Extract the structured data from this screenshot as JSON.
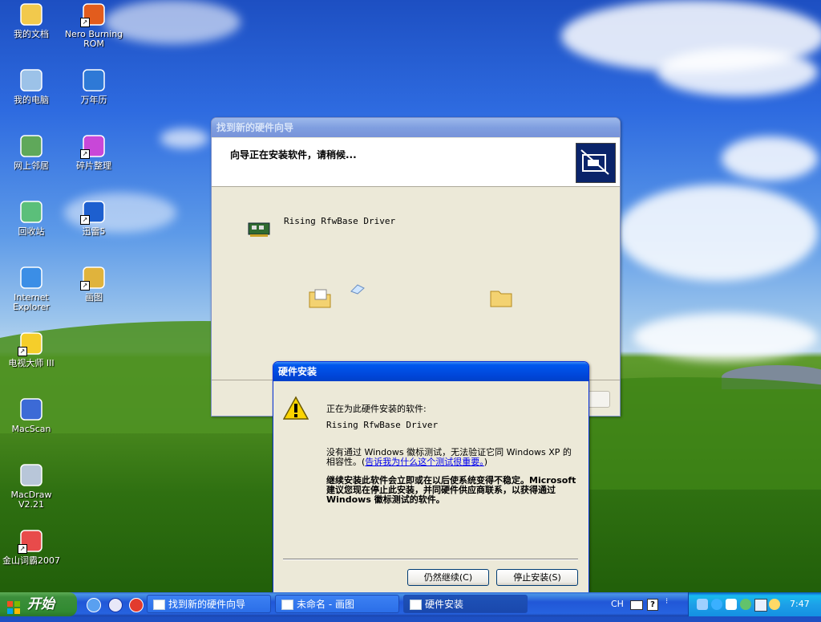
{
  "desktop": {
    "icons": [
      {
        "label": "我的文档",
        "icon": "my-documents-icon",
        "shortcut": false
      },
      {
        "label": "Nero Burning\nROM",
        "icon": "nero-burning-rom-icon",
        "shortcut": true
      },
      {
        "label": "我的电脑",
        "icon": "my-computer-icon",
        "shortcut": false
      },
      {
        "label": "万年历",
        "icon": "calendar-icon",
        "shortcut": false
      },
      {
        "label": "网上邻居",
        "icon": "network-places-icon",
        "shortcut": false
      },
      {
        "label": "碎片整理",
        "icon": "defrag-icon",
        "shortcut": true
      },
      {
        "label": "回收站",
        "icon": "recycle-bin-icon",
        "shortcut": false
      },
      {
        "label": "迅雷5",
        "icon": "thunder-icon",
        "shortcut": true
      },
      {
        "label": "Internet\nExplorer",
        "icon": "internet-explorer-icon",
        "shortcut": false
      },
      {
        "label": "画图",
        "icon": "paint-icon",
        "shortcut": true
      },
      {
        "label": "电视大师 III",
        "icon": "tv-master-icon",
        "shortcut": true
      },
      {
        "label": "MacScan",
        "icon": "macscan-icon",
        "shortcut": false
      },
      {
        "label": "MacDraw\nV2.21",
        "icon": "macdraw-icon",
        "shortcut": false
      },
      {
        "label": "金山词霸2007",
        "icon": "kingsoft-powerword-icon",
        "shortcut": true
      }
    ]
  },
  "wizard": {
    "title": "找到新的硬件向导",
    "header_text": "向导正在安装软件，请稍候...",
    "device_name": "Rising RfwBase Driver"
  },
  "dialog": {
    "title": "硬件安装",
    "installing_label": "正在为此硬件安装的软件:",
    "device_name": "Rising RfwBase Driver",
    "warning_text": "没有通过 Windows 徽标测试，无法验证它同 Windows XP 的相容性。(",
    "warning_link": "告诉我为什么这个测试很重要。",
    "warning_close": ")",
    "bold_text": "继续安装此软件会立即或在以后使系统变得不稳定。Microsoft 建议您现在停止此安装，并同硬件供应商联系，以获得通过 Windows 徽标测试的软件。",
    "continue_button": "仍然继续(C)",
    "stop_button": "停止安装(S)"
  },
  "taskbar": {
    "start_label": "开始",
    "tasks": [
      {
        "label": "找到新的硬件向导",
        "active": false
      },
      {
        "label": "未命名 - 画图",
        "active": false
      },
      {
        "label": "硬件安装",
        "active": true
      }
    ],
    "language": "CH",
    "clock": "7:47"
  },
  "colors": {
    "xp_title_active": "#0046d9",
    "taskbar_blue": "#245edb",
    "start_green": "#3c8f3b",
    "dialog_face": "#ece9d8"
  }
}
